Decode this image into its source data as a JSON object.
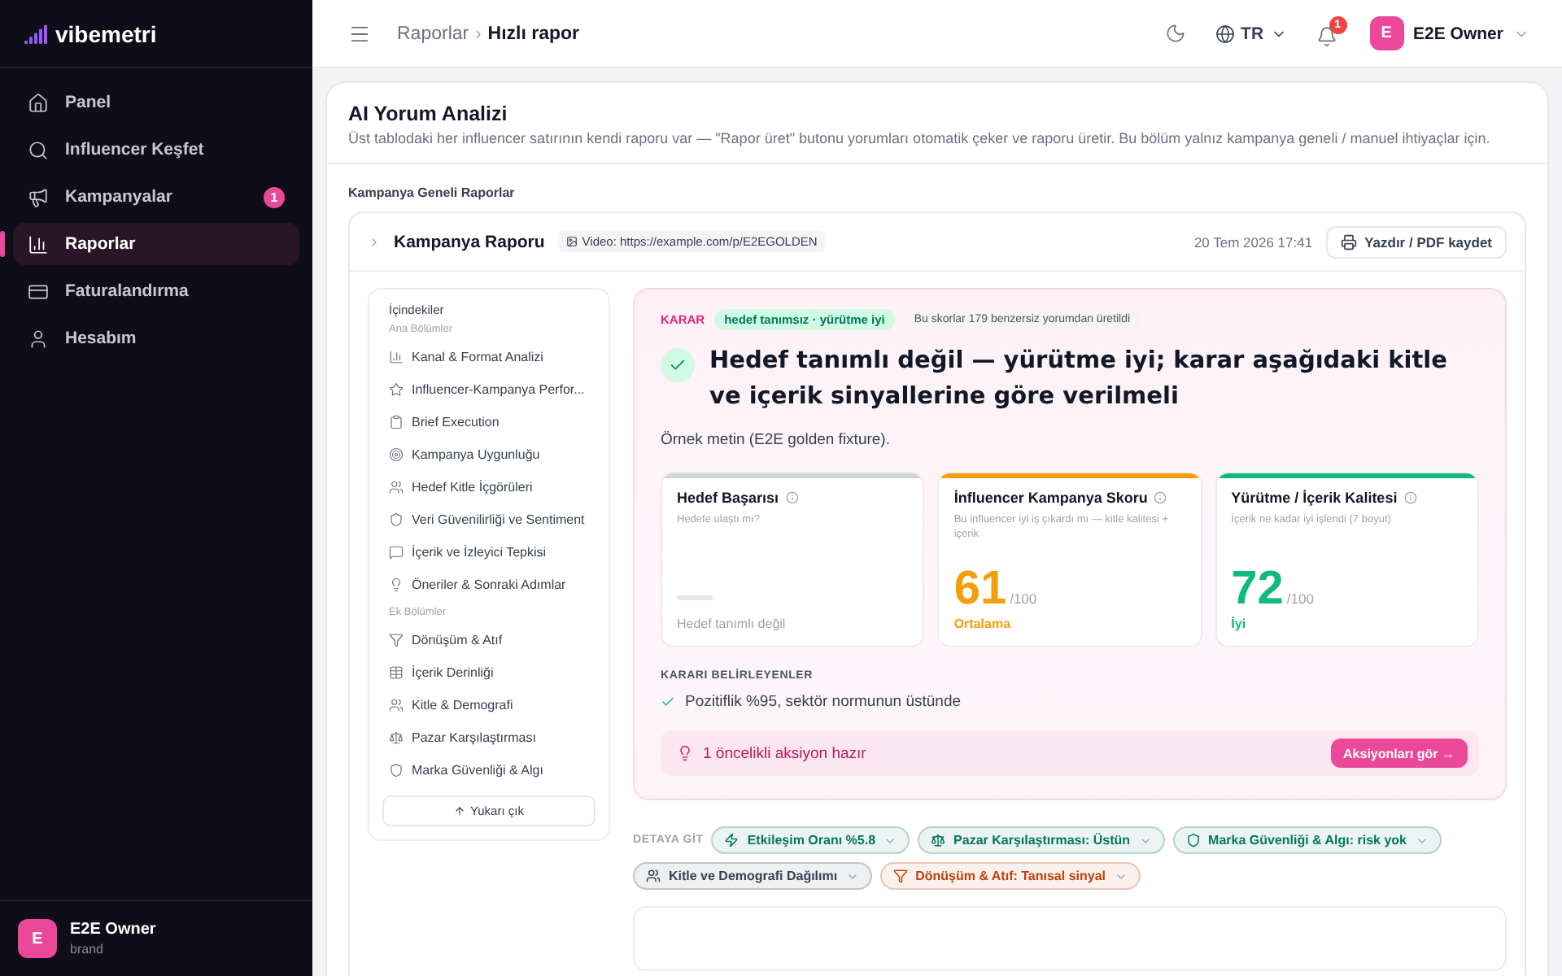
{
  "brand": {
    "name": "vibemetri"
  },
  "sidebar": {
    "items": [
      {
        "label": "Panel",
        "selected": false
      },
      {
        "label": "Influencer Keşfet",
        "selected": false
      },
      {
        "label": "Kampanyalar",
        "selected": false,
        "badge": "1"
      },
      {
        "label": "Raporlar",
        "selected": true
      },
      {
        "label": "Faturalandırma",
        "selected": false
      },
      {
        "label": "Hesabım",
        "selected": false
      }
    ],
    "user": {
      "initial": "E",
      "name": "E2E Owner",
      "role": "brand"
    }
  },
  "header": {
    "breadcrumb": [
      "Raporlar",
      "Hızlı rapor"
    ],
    "separator": "›",
    "language": "TR",
    "notifications": "1",
    "user": {
      "initial": "E",
      "name": "E2E Owner"
    }
  },
  "page": {
    "title": "AI Yorum Analizi",
    "description": "Üst tablodaki her influencer satırının kendi raporu var — \"Rapor üret\" butonu yorumları otomatik çeker ve raporu üretir. Bu bölüm yalnız kampanya geneli / manuel ihtiyaçlar için.",
    "section_title": "Kampanya Geneli Raporlar"
  },
  "report": {
    "title": "Kampanya Raporu",
    "video": "Video: https://example.com/p/E2EGOLDEN",
    "date": "20 Tem 2026 17:41",
    "print_button": "Yazdır / PDF kaydet"
  },
  "toc": {
    "title": "İçindekiler",
    "groups": [
      {
        "heading": "Ana Bölümler",
        "items": [
          "Kanal & Format Analizi",
          "Influencer-Kampanya Perfor...",
          "Brief Execution",
          "Kampanya Uygunluğu",
          "Hedef Kitle İçgörüleri",
          "Veri Güvenilirliği ve Sentiment",
          "İçerik ve İzleyici Tepkisi",
          "Öneriler & Sonraki Adımlar"
        ]
      },
      {
        "heading": "Ek Bölümler",
        "items": [
          "Dönüşüm & Atıf",
          "İçerik Derinliği",
          "Kitle & Demografi",
          "Pazar Karşılaştırması",
          "Marka Güvenliği & Algı"
        ]
      }
    ],
    "up_button": "Yukarı çık"
  },
  "decision": {
    "label": "KARAR",
    "tag": "hedef tanımsız · yürütme iyi",
    "note": "Bu skorlar 179 benzersiz yorumdan üretildi",
    "headline": "Hedef tanımlı değil — yürütme iyi; karar aşağıdaki kitle ve içerik sinyallerine göre verilmeli",
    "sample": "Örnek metin (E2E golden fixture).",
    "scores": [
      {
        "kind": "empty",
        "title": "Hedef Başarısı",
        "subtitle": "Hedefe ulaştı mı?",
        "rating": "Hedef tanımlı değil",
        "color": "#d1d5db"
      },
      {
        "kind": "score",
        "title": "İnfluencer Kampanya Skoru",
        "subtitle": "Bu influencer iyi iş çıkardı mı — kitle kalitesi + içerik",
        "value": "61",
        "denominator": "/100",
        "rating": "Ortalama",
        "color": "#f59e0b"
      },
      {
        "kind": "score",
        "title": "Yürütme / İçerik Kalitesi",
        "subtitle": "İçerik ne kadar iyi işlendi (7 boyut)",
        "value": "72",
        "denominator": "/100",
        "rating": "İyi",
        "color": "#10b981"
      }
    ],
    "factors_heading": "KARARI BELİRLEYENLER",
    "factors": [
      "Pozitiflik %95, sektör normunun üstünde"
    ],
    "action": {
      "text": "1 öncelikli aksiyon hazır",
      "button": "Aksiyonları gör →"
    }
  },
  "detail": {
    "label": "DETAYA GİT",
    "chips": [
      {
        "label": "Etkileşim Oranı %5.8",
        "color": "#047857"
      },
      {
        "label": "Pazar Karşılaştırması: Üstün",
        "color": "#047857"
      },
      {
        "label": "Marka Güvenliği & Algı: risk yok",
        "color": "#047857"
      },
      {
        "label": "Kitle ve Demografi Dağılımı",
        "color": "#374151"
      },
      {
        "label": "Dönüşüm & Atıf: Tanısal sinyal",
        "color": "#c2410c"
      }
    ]
  }
}
